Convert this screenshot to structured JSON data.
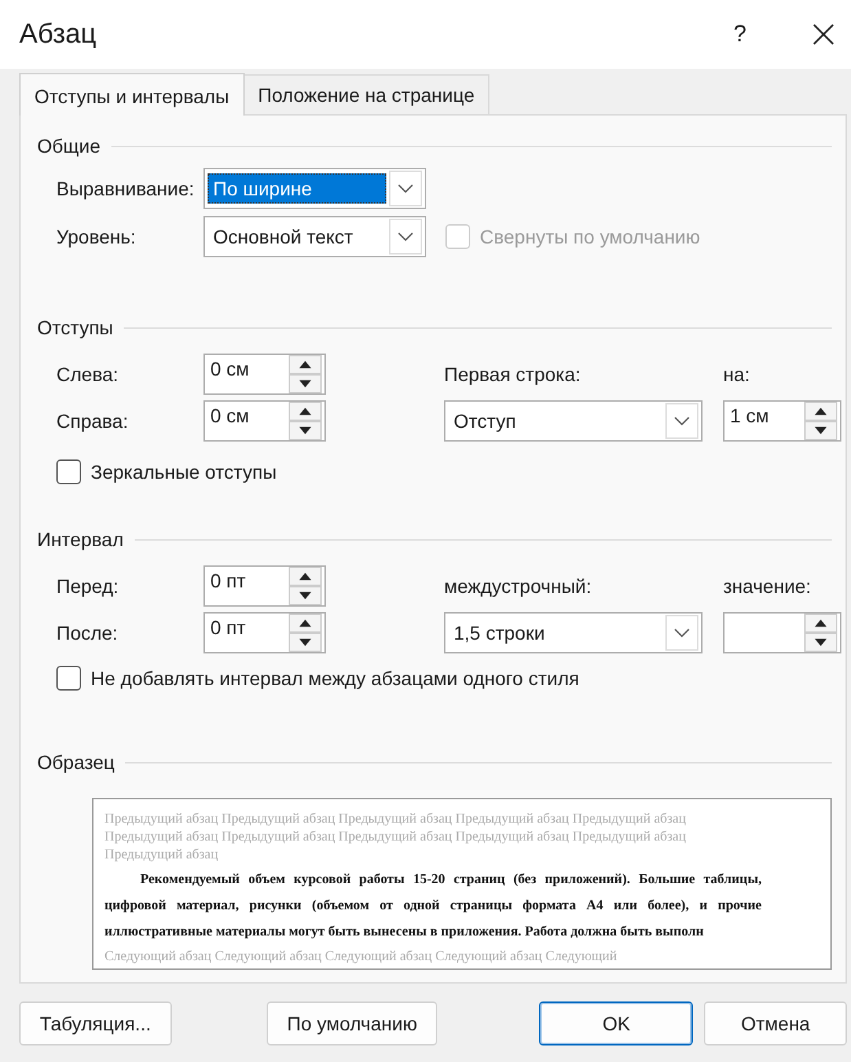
{
  "window": {
    "title": "Абзац",
    "help_button": "?"
  },
  "tabs": [
    {
      "label": "Отступы и интервалы",
      "selected": true
    },
    {
      "label": "Положение на странице",
      "selected": false
    }
  ],
  "general": {
    "heading": "Общие",
    "alignment": {
      "label": "Выравнивание:",
      "value": "По ширине",
      "focused": true
    },
    "outline_level": {
      "label": "Уровень:",
      "value": "Основной текст",
      "focused": false
    },
    "collapsed": {
      "label": "Свернуты по умолчанию",
      "checked": false,
      "disabled": true
    }
  },
  "indents": {
    "heading": "Отступы",
    "left": {
      "label": "Слева:",
      "value": "0 см"
    },
    "right": {
      "label": "Справа:",
      "value": "0 см"
    },
    "first_line": {
      "label": "Первая строка:",
      "value": "Отступ",
      "focused": false
    },
    "by": {
      "label": "на:",
      "value": "1 см"
    },
    "mirror": {
      "label": "Зеркальные отступы",
      "checked": false,
      "disabled": false
    }
  },
  "spacing": {
    "heading": "Интервал",
    "before": {
      "label": "Перед:",
      "value": "0 пт"
    },
    "after": {
      "label": "После:",
      "value": "0 пт"
    },
    "line_spacing": {
      "label": "междустрочный:",
      "value": "1,5 строки",
      "focused": false
    },
    "at": {
      "label": "значение:"
    },
    "no_space": {
      "label": "Не добавлять интервал между абзацами одного стиля",
      "checked": false,
      "disabled": false
    }
  },
  "preview": {
    "heading": "Образец",
    "previous_lines": [
      "Предыдущий абзац Предыдущий абзац Предыдущий абзац Предыдущий абзац Предыдущий абзац",
      "Предыдущий абзац Предыдущий абзац Предыдущий абзац Предыдущий абзац Предыдущий абзац",
      "Предыдущий абзац"
    ],
    "current": "Рекомендуемый объем курсовой работы 15-20 страниц (без приложений). Большие таблицы, цифровой материал, рисунки (объемом от одной страницы формата А4 или более), и прочие иллюстративные материалы могут быть вынесены в приложения. Работа должна быть выполн",
    "next_lines": [
      "Следующий абзац Следующий абзац Следующий абзац Следующий абзац Следующий"
    ]
  },
  "buttons": [
    {
      "label": "Табуляция...",
      "default": false
    },
    {
      "label": "По умолчанию",
      "default": false
    },
    {
      "label": "OK",
      "default": true
    },
    {
      "label": "Отмена",
      "default": false
    }
  ]
}
